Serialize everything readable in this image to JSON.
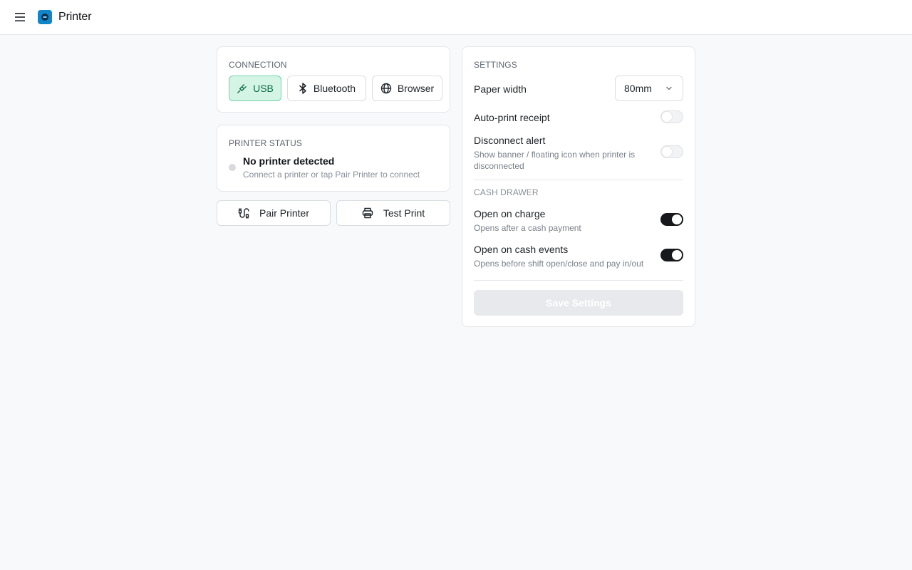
{
  "header": {
    "app_title": "Printer",
    "menu_icon": "hamburger-menu-icon",
    "logo_icon": "printer-app-logo-icon"
  },
  "connection": {
    "label": "CONNECTION",
    "options": [
      {
        "label": "USB",
        "icon": "usb-plug-icon",
        "active": true
      },
      {
        "label": "Bluetooth",
        "icon": "bluetooth-icon",
        "active": false
      },
      {
        "label": "Browser",
        "icon": "globe-icon",
        "active": false
      }
    ],
    "active_color": "#d4f5e6"
  },
  "printer_status": {
    "label": "PRINTER STATUS",
    "title": "No printer detected",
    "subtitle": "Connect a printer or tap Pair Printer to connect"
  },
  "actions": {
    "pair_label": "Pair Printer",
    "test_label": "Test Print"
  },
  "settings": {
    "label": "SETTINGS",
    "paper_width": {
      "label": "Paper width",
      "value": "80mm"
    },
    "auto_print": {
      "label": "Auto-print receipt",
      "enabled": false
    },
    "disconnect_alert": {
      "label": "Disconnect alert",
      "description": "Show banner / floating icon when printer is disconnected",
      "enabled": false
    },
    "cash_drawer_label": "CASH DRAWER",
    "open_on_charge": {
      "label": "Open on charge",
      "description": "Opens after a cash payment",
      "enabled": true
    },
    "open_on_cash_events": {
      "label": "Open on cash events",
      "description": "Opens before shift open/close and pay in/out",
      "enabled": true
    },
    "save_label": "Save Settings"
  }
}
